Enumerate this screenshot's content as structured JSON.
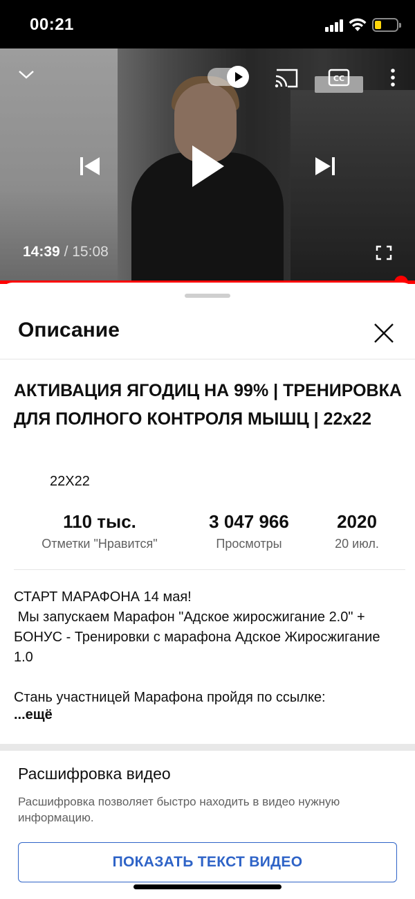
{
  "status_bar": {
    "time": "00:21",
    "icons": [
      "signal-icon",
      "wifi-icon",
      "battery-icon"
    ],
    "battery_color": "#ffd60a"
  },
  "player": {
    "current_time": "14:39",
    "separator": "/",
    "duration": "15:08",
    "progress_fraction": 0.967,
    "progress_color": "#ff0000",
    "icons": [
      "chevron-down-icon",
      "autoplay-toggle-icon",
      "cast-icon",
      "captions-icon",
      "more-vert-icon",
      "previous-icon",
      "play-icon",
      "next-icon",
      "fullscreen-icon"
    ]
  },
  "description_sheet": {
    "title": "Описание",
    "video_title": "АКТИВАЦИЯ ЯГОДИЦ НА 99% | ТРЕНИРОВКА ДЛЯ ПОЛНОГО КОНТРОЛЯ МЫШЦ | 22x22",
    "channel": "22X22",
    "stats": {
      "likes_value": "110 тыс.",
      "likes_label": "Отметки \"Нравится\"",
      "views_value": "3 047 966",
      "views_label": "Просмотры",
      "year_value": "2020",
      "date_label": "20 июл."
    },
    "description_text": "СТАРТ МАРАФОНА 14 мая!\n Мы запускаем Марафон \"Адское жиросжигание 2.0\" + БОНУС - Тренировки с марафона Адское Жиросжигание 1.0\n\nСтань участницей Марафона пройдя по ссылке:",
    "more_label": "...ещё"
  },
  "transcript": {
    "title": "Расшифровка видео",
    "text": "Расшифровка позволяет быстро находить в видео нужную информацию.",
    "button_label": "ПОКАЗАТЬ ТЕКСТ ВИДЕО",
    "accent_color": "#2e63c7"
  }
}
